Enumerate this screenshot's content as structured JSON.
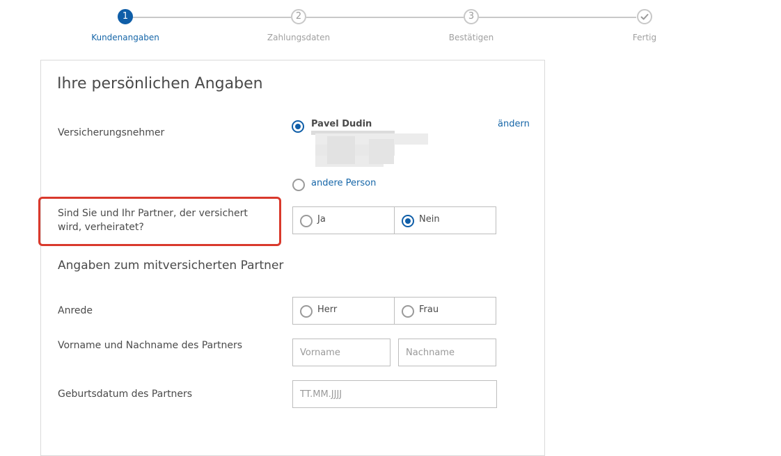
{
  "stepper": {
    "steps": [
      {
        "number": "1",
        "label": "Kundenangaben",
        "state": "active"
      },
      {
        "number": "2",
        "label": "Zahlungsdaten",
        "state": "upcoming"
      },
      {
        "number": "3",
        "label": "Bestätigen",
        "state": "upcoming"
      },
      {
        "number": "",
        "label": "Fertig",
        "state": "done-icon",
        "icon": "checkmark-icon"
      }
    ]
  },
  "card": {
    "title": "Ihre persönlichen Angaben",
    "policyholder": {
      "label": "Versicherungsnehmer",
      "selected_name": "Pavel Dudin",
      "change_link": "ändern",
      "other_option": "andere Person"
    },
    "married_question": {
      "label_line1": "Sind Sie und Ihr Partner, der versichert",
      "label_line2": "wird, verheiratet?",
      "options": [
        "Ja",
        "Nein"
      ],
      "selected": "Nein"
    },
    "partner_section_title": "Angaben zum mitversicherten Partner",
    "salutation": {
      "label": "Anrede",
      "options": [
        "Herr",
        "Frau"
      ]
    },
    "name": {
      "label": "Vorname und Nachname des Partners",
      "first_placeholder": "Vorname",
      "last_placeholder": "Nachname"
    },
    "birthdate": {
      "label": "Geburtsdatum des Partners",
      "placeholder": "TT.MM.JJJJ"
    }
  },
  "colors": {
    "accent": "#0f5ea8",
    "link": "#1666a8",
    "highlight": "#d9392c"
  }
}
